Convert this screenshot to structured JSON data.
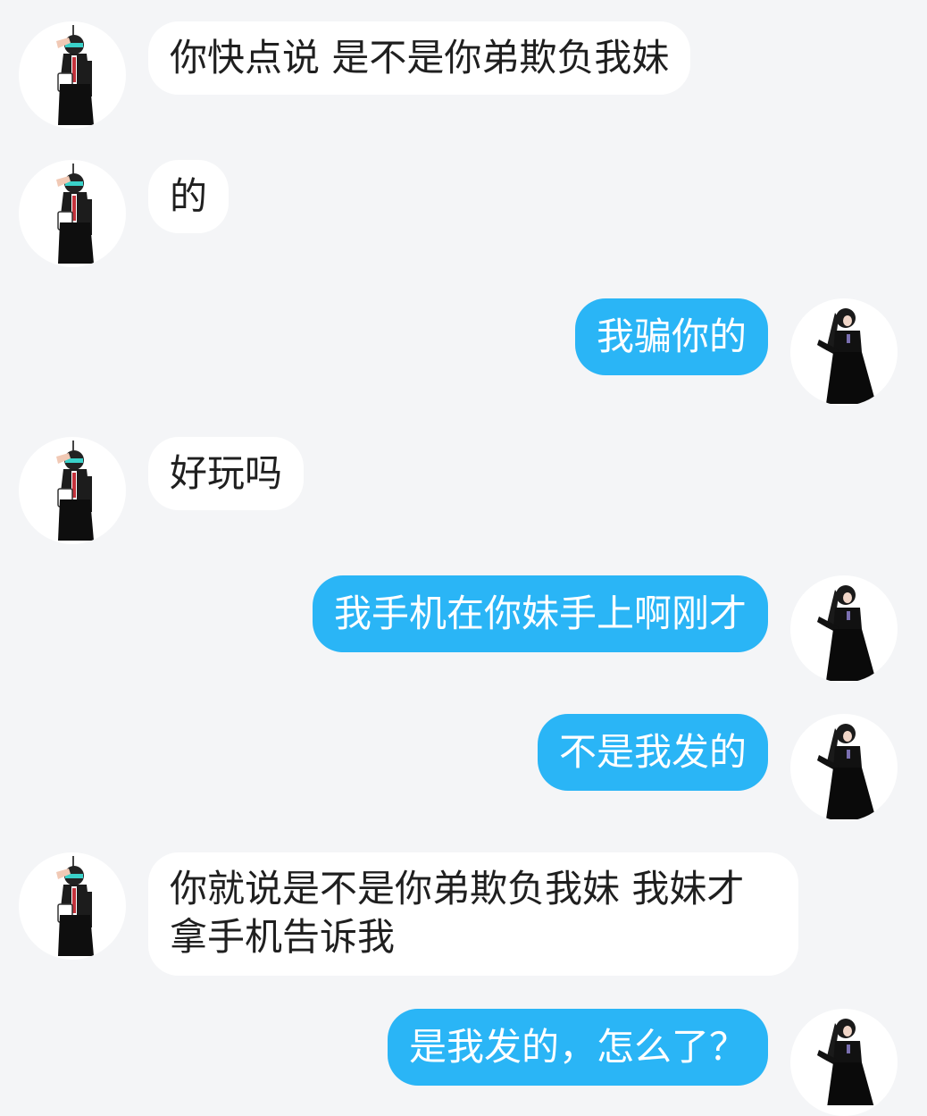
{
  "chat": {
    "messages": [
      {
        "side": "left",
        "text": "你快点说 是不是你弟欺负我妹"
      },
      {
        "side": "left",
        "text": "的"
      },
      {
        "side": "right",
        "text": "我骗你的"
      },
      {
        "side": "left",
        "text": "好玩吗"
      },
      {
        "side": "right",
        "text": "我手机在你妹手上啊刚才"
      },
      {
        "side": "right",
        "text": "不是我发的"
      },
      {
        "side": "left",
        "text": "你就说是不是你弟欺负我妹 我妹才拿手机告诉我"
      },
      {
        "side": "right",
        "text": "是我发的，怎么了？"
      }
    ]
  },
  "colors": {
    "background": "#f4f5f7",
    "incoming_bubble": "#ffffff",
    "outgoing_bubble": "#2ab5f6",
    "incoming_text": "#1f1f1f",
    "outgoing_text": "#ffffff"
  },
  "icons": {
    "other_avatar": "anime-character-avatar",
    "self_avatar": "gothic-dress-character-avatar"
  }
}
